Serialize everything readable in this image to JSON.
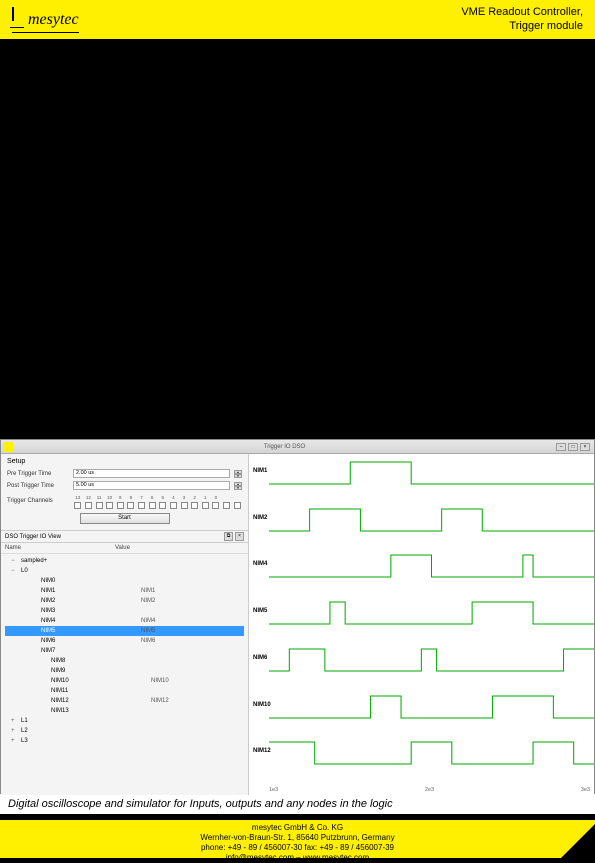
{
  "header": {
    "logo": "mesytec",
    "title_line1": "VME Readout Controller,",
    "title_line2": "Trigger module"
  },
  "app": {
    "window_title": "Trigger IO DSO",
    "setup": {
      "section_title": "Setup",
      "pretrigger_label": "Pre Trigger Time",
      "pretrigger_value": "2.00 us",
      "posttrigger_label": "Post Trigger Time",
      "posttrigger_value": "5.00 us",
      "channels_label": "Trigger Channels",
      "channel_headers": [
        "13",
        "12",
        "11",
        "10",
        "9",
        "8",
        "7",
        "6",
        "5",
        "4",
        "3",
        "2",
        "1",
        "0"
      ],
      "start_button": "Start"
    },
    "traces": {
      "panel_title": "DSO Trigger IO View",
      "col_name": "Name",
      "col_value": "Value",
      "nodes": [
        {
          "type": "group",
          "name": "sampled+",
          "expand": "−"
        },
        {
          "type": "group",
          "name": "L0",
          "expand": "−"
        },
        {
          "type": "child",
          "name": "NIM0",
          "value": ""
        },
        {
          "type": "child",
          "name": "NIM1",
          "value": "NIM1"
        },
        {
          "type": "child",
          "name": "NIM2",
          "value": "NIM2"
        },
        {
          "type": "child",
          "name": "NIM3",
          "value": ""
        },
        {
          "type": "child",
          "name": "NIM4",
          "value": "NIM4"
        },
        {
          "type": "child",
          "name": "NIM5",
          "value": "NIM5",
          "sel": true
        },
        {
          "type": "child",
          "name": "NIM6",
          "value": "NIM6"
        },
        {
          "type": "child",
          "name": "NIM7",
          "value": ""
        },
        {
          "type": "child2",
          "name": "NIM8",
          "value": ""
        },
        {
          "type": "child2",
          "name": "NIM9",
          "value": ""
        },
        {
          "type": "child2",
          "name": "NIM10",
          "value": "NIM10"
        },
        {
          "type": "child2",
          "name": "NIM11",
          "value": ""
        },
        {
          "type": "child2",
          "name": "NIM12",
          "value": "NIM12"
        },
        {
          "type": "child2",
          "name": "NIM13",
          "value": ""
        },
        {
          "type": "group",
          "name": "L1",
          "expand": "+"
        },
        {
          "type": "group",
          "name": "L2",
          "expand": "+"
        },
        {
          "type": "group",
          "name": "L3",
          "expand": "+"
        }
      ]
    },
    "scope": {
      "labels": [
        "NIM1",
        "NIM2",
        "NIM4",
        "NIM5",
        "NIM6",
        "NIM10",
        "NIM12"
      ],
      "xscale": [
        "1e3",
        "2e3",
        "3e3"
      ]
    }
  },
  "caption": "Digital oscilloscope and simulator for Inputs, outputs and any nodes in the logic",
  "footer": {
    "line1": "mesytec GmbH & Co. KG",
    "line2": "Wernher-von-Braun-Str. 1, 85640 Putzbrunn, Germany",
    "line3": "phone: +49 - 89 / 456007-30   fax: +49 - 89 / 456007-39",
    "line4": "info@mesytec.com – www.mesytec.com"
  }
}
